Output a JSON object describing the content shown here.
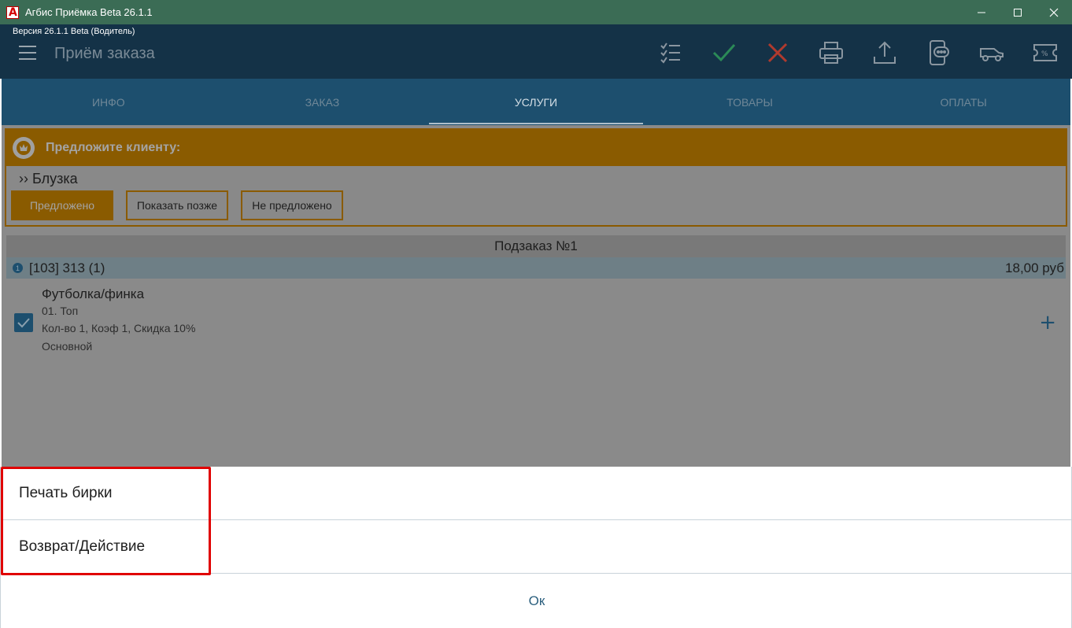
{
  "window": {
    "title": "Агбис Приёмка Beta 26.1.1",
    "controls": {
      "minimize": "minimize-icon",
      "maximize": "maximize-icon",
      "close": "close-icon"
    }
  },
  "header": {
    "version": "Версия 26.1.1 Beta (Водитель)",
    "title": "Приём заказа",
    "toolbar_icons": [
      "checklist-icon",
      "check-icon",
      "cross-icon",
      "printer-icon",
      "upload-icon",
      "phone-message-icon",
      "car-icon",
      "discount-ticket-icon"
    ],
    "accent_check": "#2b8a57",
    "accent_cross": "#b03a2e"
  },
  "tabs": [
    {
      "label": "ИНФО"
    },
    {
      "label": "ЗАКАЗ"
    },
    {
      "label": "УСЛУГИ"
    },
    {
      "label": "ТОВАРЫ"
    },
    {
      "label": "ОПЛАТЫ"
    }
  ],
  "active_tab": "УСЛУГИ",
  "suggest": {
    "title": "Предложите клиенту:",
    "item": "›› Блузка",
    "buttons": {
      "offered": "Предложено",
      "later": "Показать позже",
      "not_offered": "Не предложено"
    }
  },
  "suborder": {
    "title": "Подзаказ №1",
    "info_badge": "1",
    "order_label": "[103] 313 (1)",
    "price": "18,00 руб"
  },
  "item": {
    "name": "Футболка/финка",
    "category": "01. Топ",
    "details": "Кол-во 1, Коэф 1, Скидка 10%",
    "type": "Основной",
    "add_symbol": "+"
  },
  "sheet": {
    "options": [
      "Печать бирки",
      "Возврат/Действие"
    ],
    "ok": "Ок"
  }
}
